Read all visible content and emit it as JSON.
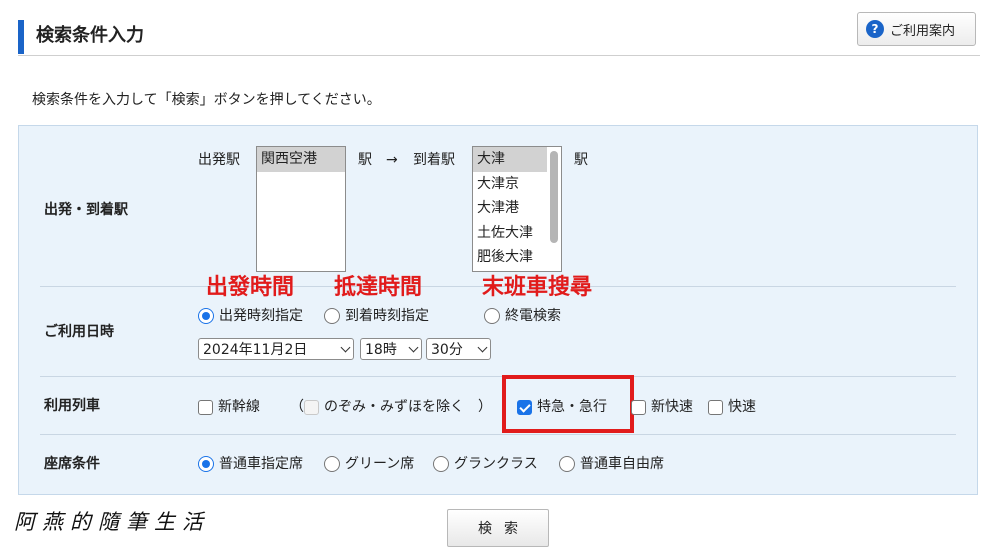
{
  "header": {
    "title": "検索条件入力",
    "help_label": "ご利用案内",
    "help_icon_glyph": "?"
  },
  "instruction": "検索条件を入力して「検索」ボタンを押してください。",
  "stations": {
    "label": "出発・到着駅",
    "departure_label": "出発駅",
    "departure_options": [
      "関西空港"
    ],
    "station_suffix": "駅",
    "arrow": "→",
    "arrival_label": "到着駅",
    "arrival_options": [
      "大津",
      "大津京",
      "大津港",
      "土佐大津",
      "肥後大津"
    ]
  },
  "datetime": {
    "label": "ご利用日時",
    "modes": [
      {
        "label": "出発時刻指定",
        "selected": true
      },
      {
        "label": "到着時刻指定",
        "selected": false
      },
      {
        "label": "終電検索",
        "selected": false
      }
    ],
    "date_value": "2024年11月2日",
    "hour_value": "18時",
    "minute_value": "30分"
  },
  "annotations": {
    "depart_time": "出發時間",
    "arrive_time": "抵達時間",
    "last_train": "末班車搜尋",
    "color": "#e11b1b"
  },
  "trains": {
    "label": "利用列車",
    "shinkansen": "新幹線",
    "paren_open": "（",
    "exclude": "のぞみ・みずほを除く",
    "paren_close": "）",
    "express": "特急・急行",
    "new_rapid": "新快速",
    "rapid": "快速"
  },
  "seats": {
    "label": "座席条件",
    "options": [
      {
        "label": "普通車指定席",
        "selected": true
      },
      {
        "label": "グリーン席",
        "selected": false
      },
      {
        "label": "グランクラス",
        "selected": false
      },
      {
        "label": "普通車自由席",
        "selected": false
      }
    ]
  },
  "search_label": "検索",
  "watermark": "阿燕的隨筆生活",
  "colors": {
    "accent": "#1a64c8",
    "panel_bg": "#eaf3fb",
    "checkbox_on": "#1a73e8"
  }
}
